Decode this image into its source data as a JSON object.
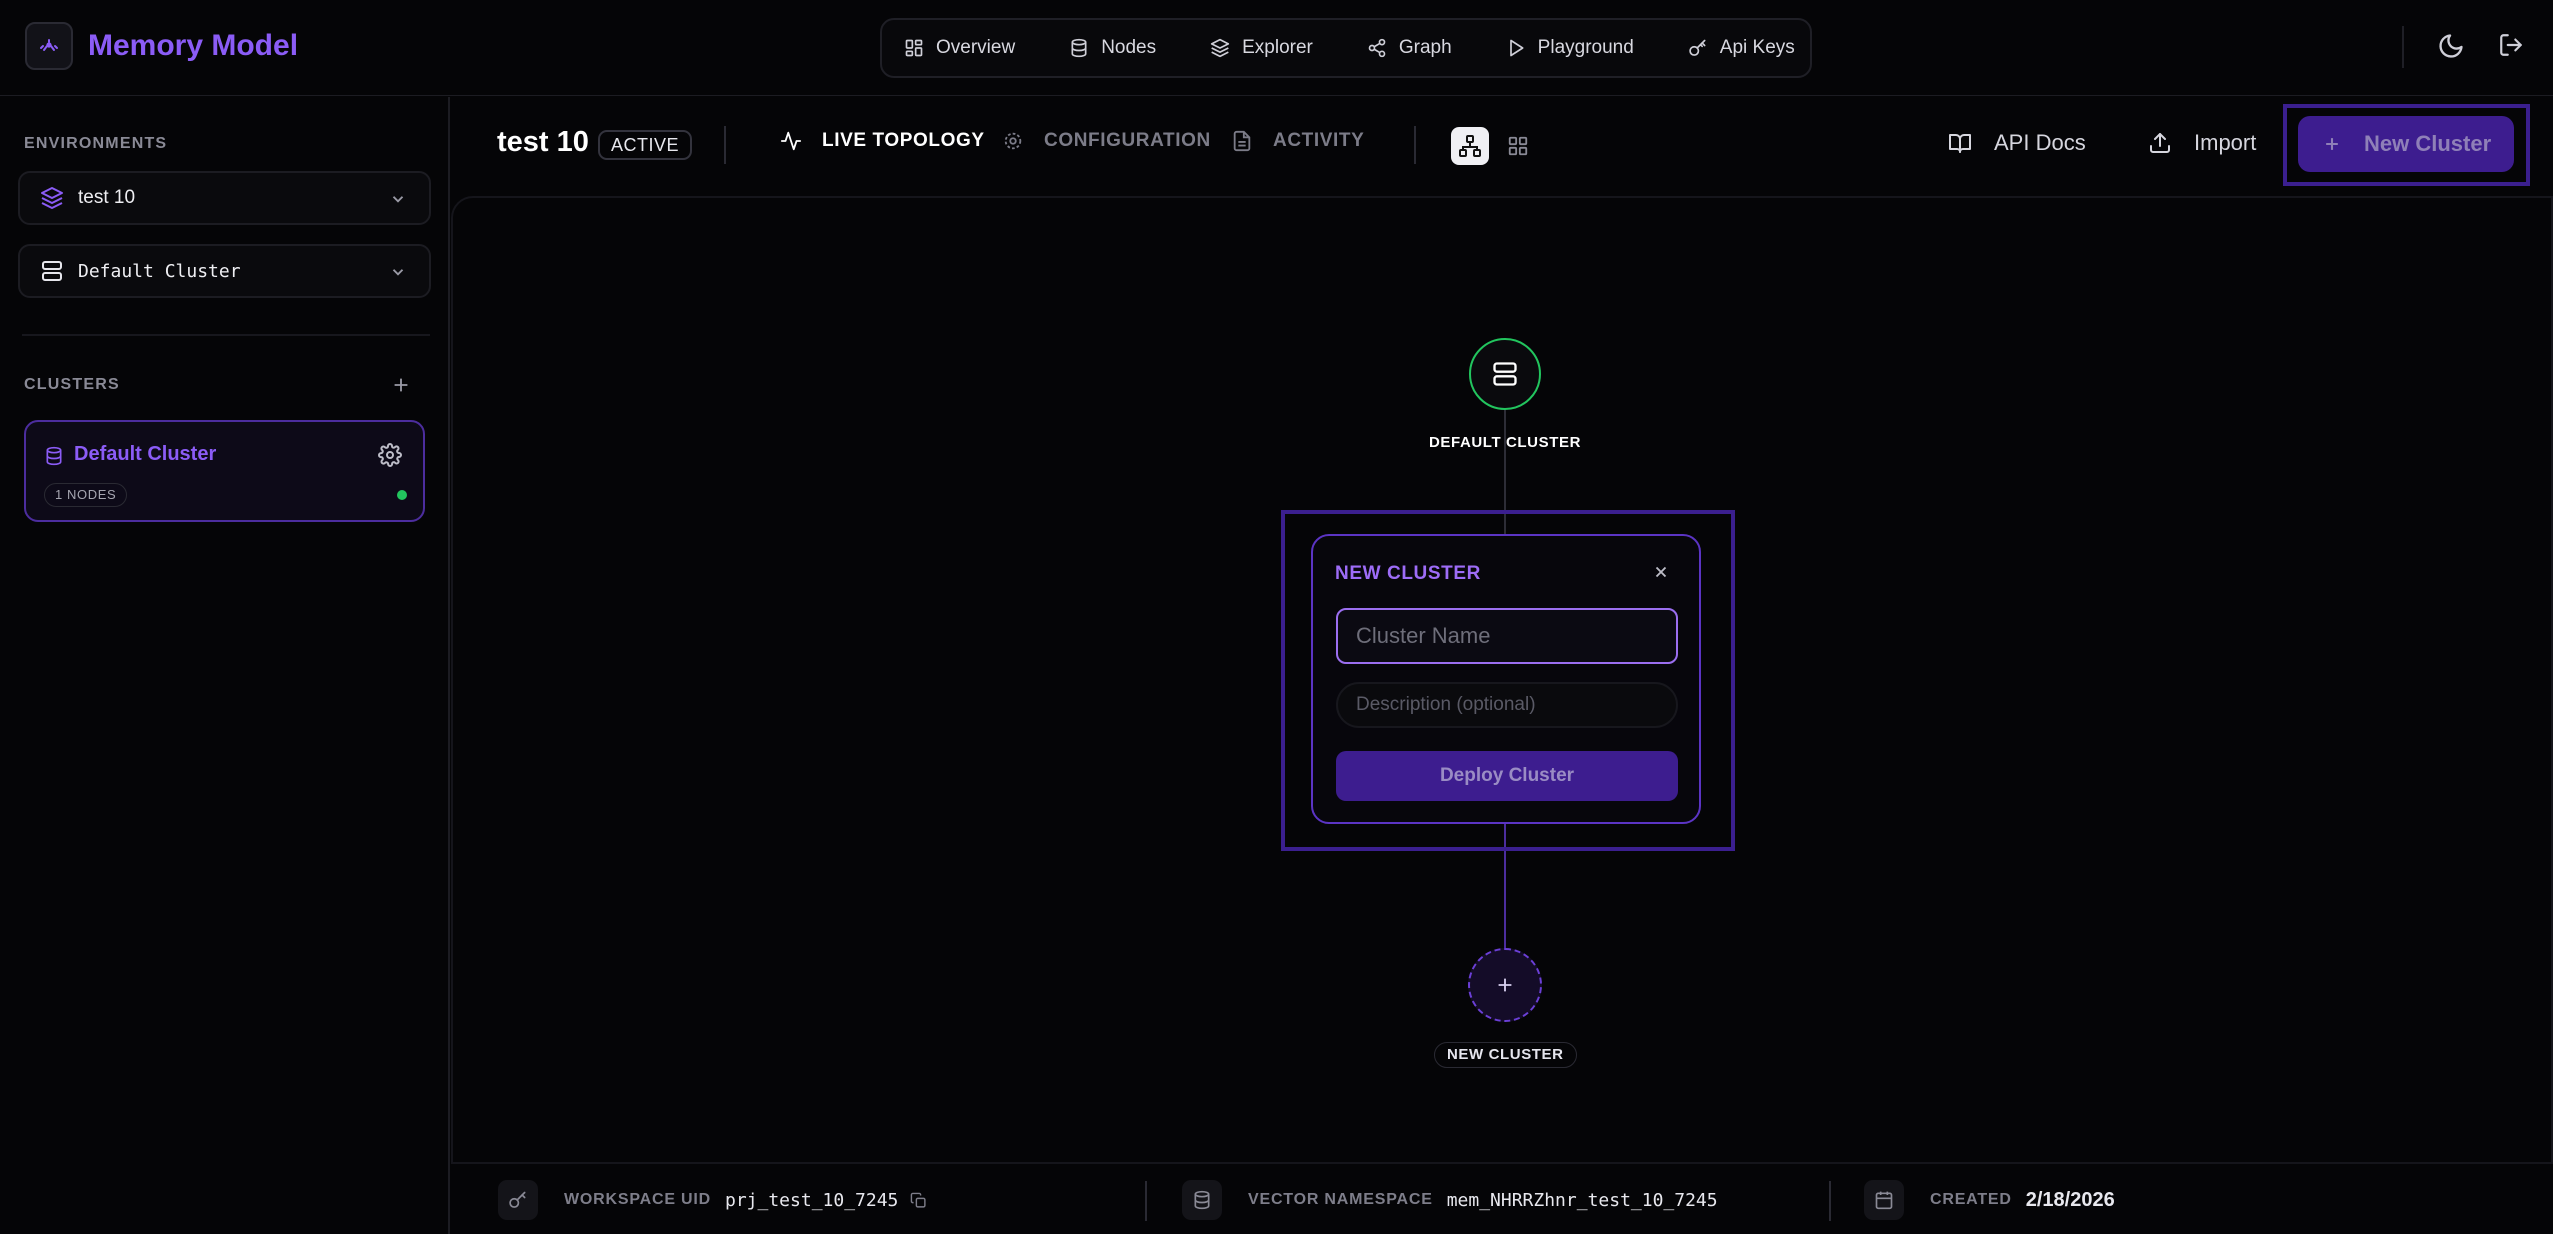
{
  "app": {
    "name": "Memory Model"
  },
  "nav": [
    {
      "label": "Overview",
      "icon": "grid-icon"
    },
    {
      "label": "Nodes",
      "icon": "database-icon"
    },
    {
      "label": "Explorer",
      "icon": "layers-icon"
    },
    {
      "label": "Graph",
      "icon": "share-icon"
    },
    {
      "label": "Playground",
      "icon": "play-icon"
    },
    {
      "label": "Api Keys",
      "icon": "key-icon"
    }
  ],
  "sidebar": {
    "environments_label": "ENVIRONMENTS",
    "environment_selected": "test 10",
    "cluster_selected": "Default Cluster",
    "clusters_label": "CLUSTERS",
    "clusters": [
      {
        "name": "Default Cluster",
        "nodes_badge": "1 NODES",
        "status_color": "#22c55e"
      }
    ]
  },
  "header": {
    "title": "test 10",
    "status": "ACTIVE",
    "tabs": [
      {
        "label": "LIVE TOPOLOGY",
        "active": true
      },
      {
        "label": "CONFIGURATION",
        "active": false
      },
      {
        "label": "ACTIVITY",
        "active": false
      }
    ],
    "api_docs_label": "API Docs",
    "import_label": "Import",
    "new_cluster_label": "New Cluster"
  },
  "topology": {
    "default_node_label": "DEFAULT CLUSTER",
    "new_node_label": "NEW CLUSTER"
  },
  "popup": {
    "title": "NEW CLUSTER",
    "name_placeholder": "Cluster Name",
    "name_value": "",
    "description_placeholder": "Description (optional)",
    "description_value": "",
    "submit_label": "Deploy Cluster"
  },
  "footer": {
    "workspace_uid_label": "WORKSPACE UID",
    "workspace_uid_value": "prj_test_10_7245",
    "vector_namespace_label": "VECTOR NAMESPACE",
    "vector_namespace_value": "mem_NHRRZhnr_test_10_7245",
    "created_label": "CREATED",
    "created_value": "2/18/2026"
  },
  "colors": {
    "accent": "#8b5cf6",
    "accent_dark": "#3d1d8f",
    "status_active": "#22c55e",
    "background": "#050507"
  }
}
